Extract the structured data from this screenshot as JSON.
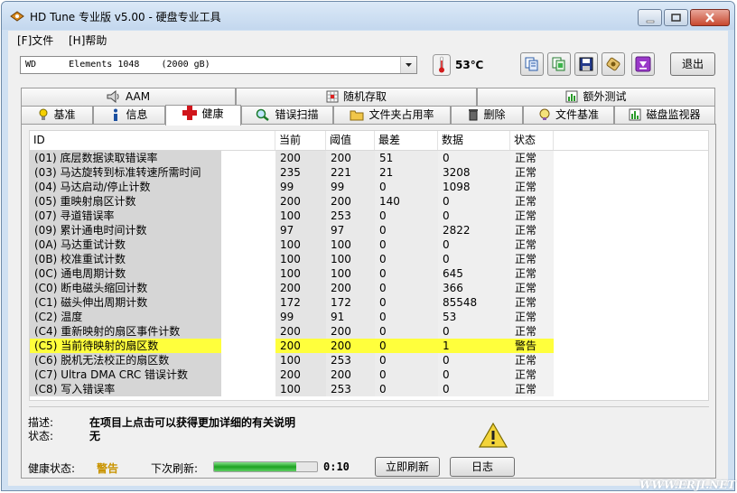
{
  "window": {
    "title": "HD Tune 专业版 v5.00 - 硬盘专业工具"
  },
  "menu": [
    "[F]文件",
    "[H]帮助"
  ],
  "toolbar": {
    "drive": "WD      Elements 1048    (2000 gB)",
    "temperature": "53℃",
    "exit_label": "退出",
    "icons": [
      "copy-info-icon",
      "copy-screen-icon",
      "save-icon",
      "options-icon",
      "download-icon"
    ]
  },
  "tabs_row1": [
    {
      "label": "AAM",
      "icon": "speaker-icon"
    },
    {
      "label": "随机存取",
      "icon": "random-grid-icon"
    },
    {
      "label": "额外测试",
      "icon": "extra-test-icon"
    }
  ],
  "tabs_row2": [
    {
      "label": "基准",
      "icon": "bulb-icon"
    },
    {
      "label": "信息",
      "icon": "info-icon"
    },
    {
      "label": "健康",
      "icon": "red-cross-icon",
      "active": true
    },
    {
      "label": "错误扫描",
      "icon": "magnifier-icon"
    },
    {
      "label": "文件夹占用率",
      "icon": "folder-icon"
    },
    {
      "label": "删除",
      "icon": "trash-icon"
    },
    {
      "label": "文件基准",
      "icon": "file-bench-icon"
    },
    {
      "label": "磁盘监视器",
      "icon": "monitor-icon"
    }
  ],
  "health_table": {
    "columns": [
      "ID",
      "当前",
      "阈值",
      "最差",
      "数据",
      "状态"
    ],
    "rows": [
      [
        "(01) 底层数据读取错误率",
        "200",
        "200",
        "51",
        "0",
        "正常"
      ],
      [
        "(03) 马达旋转到标准转速所需时间",
        "235",
        "221",
        "21",
        "3208",
        "正常"
      ],
      [
        "(04) 马达启动/停止计数",
        "99",
        "99",
        "0",
        "1098",
        "正常"
      ],
      [
        "(05) 重映射扇区计数",
        "200",
        "200",
        "140",
        "0",
        "正常"
      ],
      [
        "(07) 寻道错误率",
        "100",
        "253",
        "0",
        "0",
        "正常"
      ],
      [
        "(09) 累计通电时间计数",
        "97",
        "97",
        "0",
        "2822",
        "正常"
      ],
      [
        "(0A) 马达重试计数",
        "100",
        "100",
        "0",
        "0",
        "正常"
      ],
      [
        "(0B) 校准重试计数",
        "100",
        "100",
        "0",
        "0",
        "正常"
      ],
      [
        "(0C) 通电周期计数",
        "100",
        "100",
        "0",
        "645",
        "正常"
      ],
      [
        "(C0) 断电磁头缩回计数",
        "200",
        "200",
        "0",
        "366",
        "正常"
      ],
      [
        "(C1) 磁头伸出周期计数",
        "172",
        "172",
        "0",
        "85548",
        "正常"
      ],
      [
        "(C2) 温度",
        "99",
        "91",
        "0",
        "53",
        "正常"
      ],
      [
        "(C4) 重新映射的扇区事件计数",
        "200",
        "200",
        "0",
        "0",
        "正常"
      ],
      [
        "(C5) 当前待映射的扇区数",
        "200",
        "200",
        "0",
        "1",
        "警告"
      ],
      [
        "(C6) 脱机无法校正的扇区数",
        "100",
        "253",
        "0",
        "0",
        "正常"
      ],
      [
        "(C7) Ultra DMA CRC 错误计数",
        "200",
        "200",
        "0",
        "0",
        "正常"
      ],
      [
        "(C8) 写入错误率",
        "100",
        "253",
        "0",
        "0",
        "正常"
      ]
    ],
    "warning_row_index": 13,
    "warning_color": "#ffff3c"
  },
  "details": {
    "desc_label": "描述:",
    "desc_value": "在项目上点击可以获得更加详细的有关说明",
    "status_label": "状态:",
    "status_value": "无"
  },
  "footer": {
    "health_label": "健康状态:",
    "health_value": "警告",
    "next_refresh_label": "下次刷新:",
    "refresh_progress_percent": 80,
    "timer": "0:10",
    "refresh_button": "立即刷新",
    "log_button": "日志"
  },
  "watermark": "WWW.ERJI.NET"
}
